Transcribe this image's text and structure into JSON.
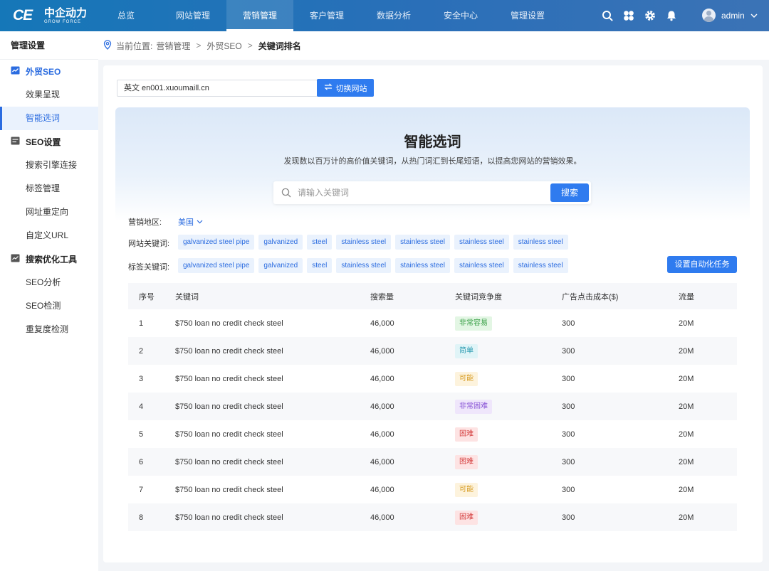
{
  "header": {
    "logo_mark": "CE",
    "logo_cn": "中企动力",
    "logo_en": "GROW FORCE",
    "nav": [
      "总览",
      "网站管理",
      "营销管理",
      "客户管理",
      "数据分析",
      "安全中心",
      "管理设置"
    ],
    "active_nav_index": 2,
    "user": "admin"
  },
  "sidebar": {
    "title": "管理设置",
    "groups": [
      {
        "label": "外贸SEO",
        "active": true,
        "items": [
          "效果呈现",
          "智能选词"
        ]
      },
      {
        "label": "SEO设置",
        "items": [
          "搜索引擎连接",
          "标签管理",
          "网址重定向",
          "自定义URL"
        ]
      },
      {
        "label": "搜索优化工具",
        "items": [
          "SEO分析",
          "SEO检测",
          "重复度检测"
        ]
      }
    ],
    "active_item": "智能选词"
  },
  "breadcrumb": {
    "prefix": "当前位置:",
    "parts": [
      "营销管理",
      "外贸SEO"
    ],
    "current": "关键词排名"
  },
  "site": {
    "value": "英文 en001.xuoumaill.cn",
    "switch_label": "切换网站"
  },
  "hero": {
    "title": "智能选词",
    "subtitle": "发现数以百万计的高价值关键词，从热门词汇到长尾短语，以提高您网站的营销效果。",
    "search_placeholder": "请输入关键词",
    "search_button": "搜索"
  },
  "filters": {
    "region_label": "营销地区:",
    "region_value": "美国",
    "site_keywords_label": "网站关键词:",
    "site_keywords": [
      "galvanized steel pipe",
      "galvanized",
      "steel",
      "stainless steel",
      "stainless steel",
      "stainless steel",
      "stainless steel"
    ],
    "tag_keywords_label": "标签关键词:",
    "tag_keywords": [
      "galvanized steel pipe",
      "galvanized",
      "steel",
      "stainless steel",
      "stainless steel",
      "stainless steel",
      "stainless steel"
    ],
    "auto_task_button": "设置自动化任务"
  },
  "table": {
    "columns": [
      "序号",
      "关键词",
      "搜索量",
      "关键词竞争度",
      "广告点击成本($)",
      "流量"
    ],
    "rows": [
      {
        "no": "1",
        "keyword": "$750 loan no credit check steel",
        "volume": "46,000",
        "difficulty": "非常容易",
        "level": "very-easy",
        "cpc": "300",
        "traffic": "20M"
      },
      {
        "no": "2",
        "keyword": "$750 loan no credit check steel",
        "volume": "46,000",
        "difficulty": "简单",
        "level": "easy",
        "cpc": "300",
        "traffic": "20M"
      },
      {
        "no": "3",
        "keyword": "$750 loan no credit check steel",
        "volume": "46,000",
        "difficulty": "可能",
        "level": "possible",
        "cpc": "300",
        "traffic": "20M"
      },
      {
        "no": "4",
        "keyword": "$750 loan no credit check steel",
        "volume": "46,000",
        "difficulty": "非常困难",
        "level": "very-hard",
        "cpc": "300",
        "traffic": "20M"
      },
      {
        "no": "5",
        "keyword": "$750 loan no credit check steel",
        "volume": "46,000",
        "difficulty": "困难",
        "level": "hard",
        "cpc": "300",
        "traffic": "20M"
      },
      {
        "no": "6",
        "keyword": "$750 loan no credit check steel",
        "volume": "46,000",
        "difficulty": "困难",
        "level": "hard",
        "cpc": "300",
        "traffic": "20M"
      },
      {
        "no": "7",
        "keyword": "$750 loan no credit check steel",
        "volume": "46,000",
        "difficulty": "可能",
        "level": "possible",
        "cpc": "300",
        "traffic": "20M"
      },
      {
        "no": "8",
        "keyword": "$750 loan no credit check steel",
        "volume": "46,000",
        "difficulty": "困难",
        "level": "hard",
        "cpc": "300",
        "traffic": "20M"
      }
    ]
  },
  "colors": {
    "accent": "#2f7bef",
    "topbar": "#2a6fb8",
    "very-easy": {
      "bg": "#e3f6e4",
      "fg": "#3aa047"
    },
    "easy": {
      "bg": "#e0f4f7",
      "fg": "#2a9ab0"
    },
    "possible": {
      "bg": "#fdf3dd",
      "fg": "#d69a1f"
    },
    "very-hard": {
      "bg": "#efe6fb",
      "fg": "#8a55d6"
    },
    "hard": {
      "bg": "#fde3e3",
      "fg": "#d64545"
    }
  }
}
